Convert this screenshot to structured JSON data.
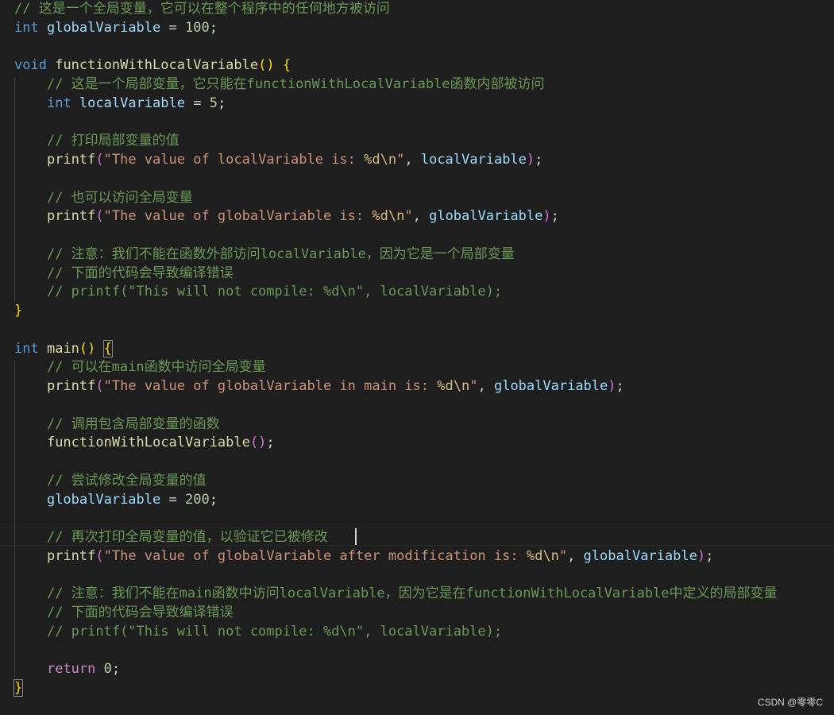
{
  "code": {
    "lines": [
      "// 这是一个全局变量，它可以在整个程序中的任何地方被访问",
      "int globalVariable = 100;",
      "",
      "void functionWithLocalVariable() {",
      "    // 这是一个局部变量，它只能在functionWithLocalVariable函数内部被访问",
      "    int localVariable = 5;",
      "",
      "    // 打印局部变量的值",
      "    printf(\"The value of localVariable is: %d\\n\", localVariable);",
      "",
      "    // 也可以访问全局变量",
      "    printf(\"The value of globalVariable is: %d\\n\", globalVariable);",
      "",
      "    // 注意：我们不能在函数外部访问localVariable，因为它是一个局部变量",
      "    // 下面的代码会导致编译错误",
      "    // printf(\"This will not compile: %d\\n\", localVariable);",
      "}",
      "",
      "int main() {",
      "    // 可以在main函数中访问全局变量",
      "    printf(\"The value of globalVariable in main is: %d\\n\", globalVariable);",
      "",
      "    // 调用包含局部变量的函数",
      "    functionWithLocalVariable();",
      "",
      "    // 尝试修改全局变量的值",
      "    globalVariable = 200;",
      "",
      "    // 再次打印全局变量的值，以验证它已被修改",
      "    printf(\"The value of globalVariable after modification is: %d\\n\", globalVariable);",
      "",
      "    // 注意：我们不能在main函数中访问localVariable，因为它是在functionWithLocalVariable中定义的局部变量",
      "    // 下面的代码会导致编译错误",
      "    // printf(\"This will not compile: %d\\n\", localVariable);",
      "",
      "    return 0;",
      "}"
    ]
  },
  "watermark": "CSDN @零零C",
  "colors": {
    "background": "#1e1e1e",
    "comment": "#6a9955",
    "keyword": "#569cd6",
    "function": "#dcdcaa",
    "variable": "#9cdcfe",
    "number": "#b5cea8",
    "string": "#ce9178",
    "escape": "#d7ba7d",
    "control": "#c586c0",
    "bracket_outer": "#ffd700",
    "bracket_inner": "#da70d6"
  }
}
